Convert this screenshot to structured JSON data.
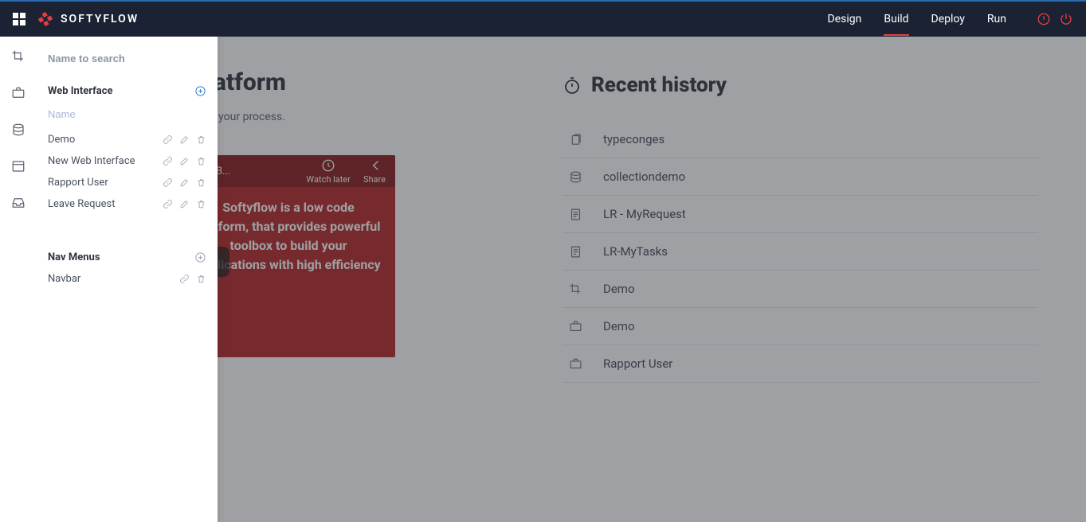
{
  "header": {
    "brand": "SOFTYFLOW",
    "nav": [
      "Design",
      "Build",
      "Deploy",
      "Run"
    ],
    "active_nav_index": 1
  },
  "sidebar": {
    "search_placeholder": "Name to search",
    "sections": [
      {
        "title": "Web Interface",
        "name_placeholder": "Name",
        "items": [
          {
            "label": "Demo"
          },
          {
            "label": "New Web Interface"
          },
          {
            "label": "Rapport User"
          },
          {
            "label": "Leave Request"
          }
        ]
      },
      {
        "title": "Nav Menus",
        "items": [
          {
            "label": "Navbar"
          }
        ]
      }
    ]
  },
  "welcome": {
    "title": "Softyflow platform",
    "subtitle": "video and start by creating your process.",
    "video_title": "Softyflow platform - Design, B...",
    "watch_later": "Watch later",
    "share": "Share",
    "video_text": "Softyflow is a low code platform, that provides powerful toolbox to build your applications with high efficiency"
  },
  "history": {
    "title": "Recent history",
    "items": [
      {
        "icon": "doc-stack",
        "label": "typeconges"
      },
      {
        "icon": "database",
        "label": "collectiondemo"
      },
      {
        "icon": "doc",
        "label": "LR - MyRequest"
      },
      {
        "icon": "doc",
        "label": "LR-MyTasks"
      },
      {
        "icon": "crop",
        "label": "Demo"
      },
      {
        "icon": "briefcase",
        "label": "Demo"
      },
      {
        "icon": "briefcase",
        "label": "Rapport User"
      }
    ]
  }
}
